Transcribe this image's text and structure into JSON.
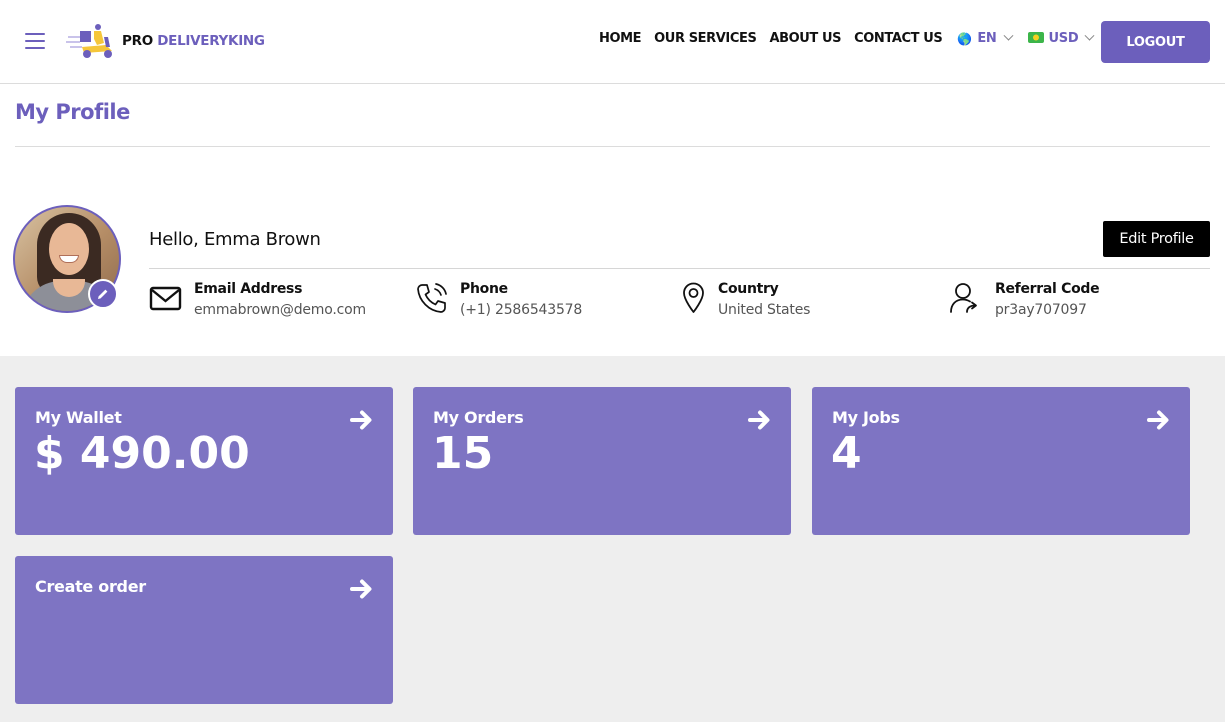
{
  "header": {
    "logo": {
      "prefix": "PRO",
      "brand": "DELIVERYKING"
    },
    "nav": [
      {
        "label": "HOME"
      },
      {
        "label": "OUR SERVICES"
      },
      {
        "label": "ABOUT US"
      },
      {
        "label": "CONTACT US"
      }
    ],
    "language": {
      "flag_icon": "globe-icon",
      "flag": "🌎",
      "code": "EN"
    },
    "currency": {
      "flag_icon": "banknote-icon",
      "flag": "💵",
      "code": "USD"
    },
    "logout_label": "LOGOUT"
  },
  "page": {
    "title": "My Profile"
  },
  "profile": {
    "greeting": "Hello, Emma Brown",
    "edit_label": "Edit Profile",
    "fields": [
      {
        "icon": "envelope-icon",
        "label": "Email Address",
        "value": "emmabrown@demo.com"
      },
      {
        "icon": "phone-icon",
        "label": "Phone",
        "value": "(+1) 2586543578"
      },
      {
        "icon": "map-pin-icon",
        "label": "Country",
        "value": "United States"
      },
      {
        "icon": "user-share-icon",
        "label": "Referral Code",
        "value": "pr3ay707097"
      }
    ]
  },
  "cards": [
    {
      "label": "My Wallet",
      "value": "$ 490.00"
    },
    {
      "label": "My Orders",
      "value": "15"
    },
    {
      "label": "My Jobs",
      "value": "4"
    },
    {
      "label": "Create order",
      "value": ""
    }
  ],
  "colors": {
    "accent": "#6c5fbc",
    "card": "#7e74c3",
    "logo_yellow": "#f5c63a"
  }
}
